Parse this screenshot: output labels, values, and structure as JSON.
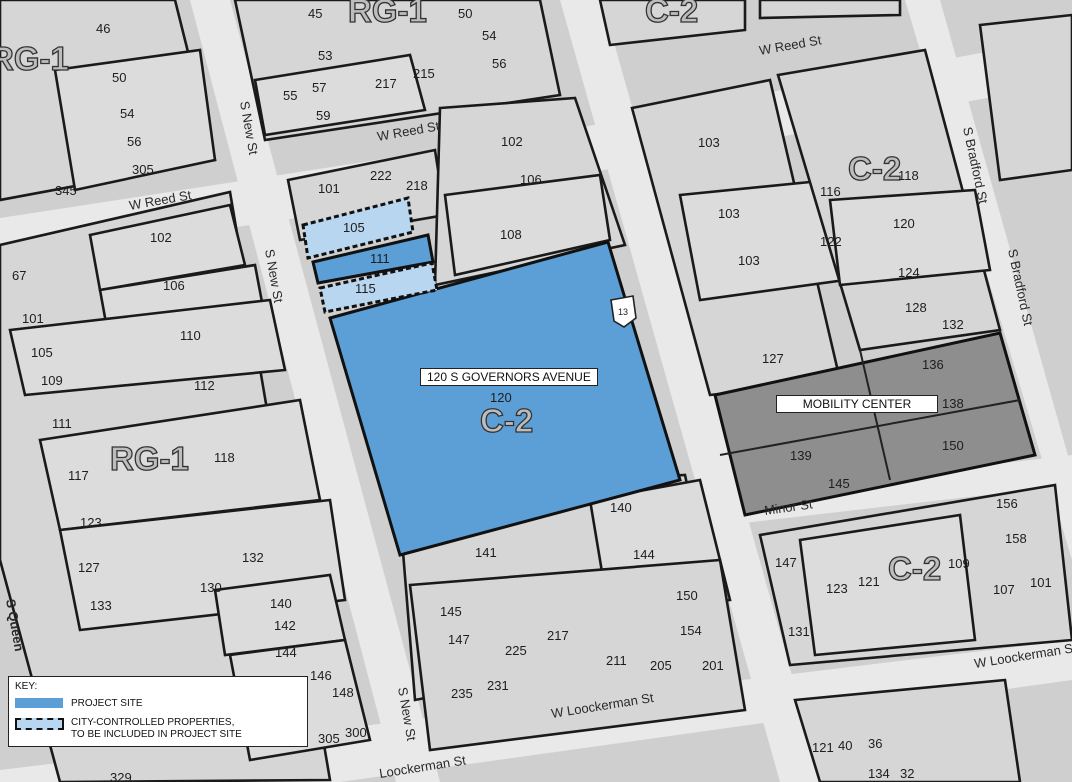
{
  "colors": {
    "project_site": "#5b9fd6",
    "city_controlled": "#b8d6ef",
    "mobility_center": "#8e8e8e",
    "lot_fill": "#d6d6d6",
    "road": "#e9e9e9"
  },
  "callouts": {
    "project_site_label": "120 S GOVERNORS AVENUE",
    "mobility_center_label": "MOBILITY CENTER"
  },
  "route_shield": "13",
  "legend": {
    "title": "KEY:",
    "project_site": "PROJECT SITE",
    "city_controlled_line1": "CITY-CONTROLLED PROPERTIES,",
    "city_controlled_line2": "TO BE INCLUDED IN PROJECT SITE"
  },
  "zoning": [
    "RG-1",
    "RG-1",
    "RG-1",
    "C-2",
    "C-2",
    "C-2",
    "C-2"
  ],
  "streets": [
    "W Reed St",
    "W Reed St",
    "W Reed St",
    "S New St",
    "S New St",
    "S New St",
    "S Bradford St",
    "S Bradford St",
    "Minor St",
    "W Loockerman St",
    "W Loockerman St",
    "Loockerman St",
    "S Queen"
  ],
  "parcels": [
    "46",
    "45",
    "50",
    "54",
    "56",
    "53",
    "57",
    "55",
    "217",
    "215",
    "59",
    "50",
    "54",
    "56",
    "305",
    "345",
    "101",
    "222",
    "218",
    "102",
    "106",
    "108",
    "105",
    "111",
    "115",
    "102",
    "67",
    "106",
    "101",
    "110",
    "105",
    "109",
    "112",
    "111",
    "117",
    "118",
    "123",
    "127",
    "133",
    "132",
    "130",
    "140",
    "142",
    "144",
    "146",
    "148",
    "305",
    "300",
    "329",
    "120",
    "103",
    "103",
    "103",
    "116",
    "118",
    "120",
    "122",
    "124",
    "128",
    "132",
    "127",
    "136",
    "138",
    "139",
    "145",
    "150",
    "140",
    "141",
    "144",
    "150",
    "145",
    "147",
    "217",
    "225",
    "231",
    "235",
    "211",
    "205",
    "201",
    "154",
    "156",
    "158",
    "147",
    "123",
    "121",
    "109",
    "107",
    "101",
    "131",
    "121",
    "40",
    "36",
    "134",
    "32"
  ]
}
